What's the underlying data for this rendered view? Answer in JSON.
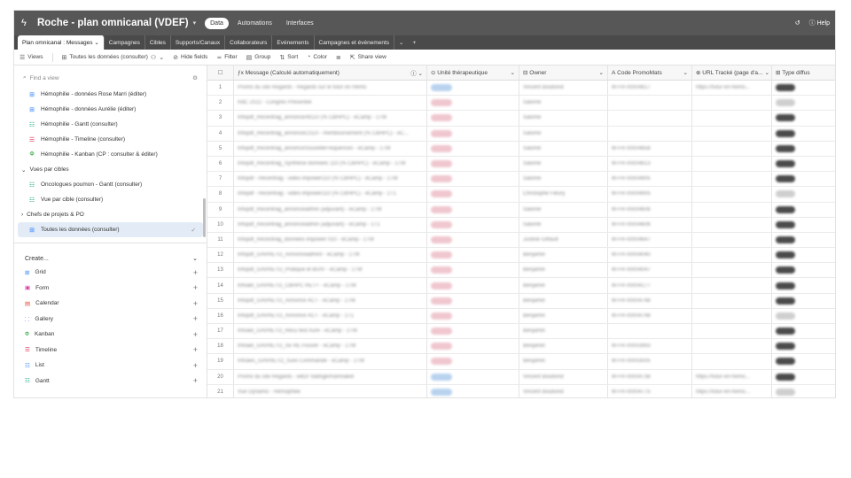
{
  "topbar": {
    "base_title": "Roche - plan omnicanal (VDEF)",
    "nav": [
      "Data",
      "Automations",
      "Interfaces"
    ],
    "help": "Help"
  },
  "tabs": [
    "Plan omnicanal : Messages",
    "Campagnes",
    "Cibles",
    "Supports/Canaux",
    "Collaborateurs",
    "Evénements",
    "Campagnes et événements"
  ],
  "viewbar": {
    "views": "Views",
    "current_view": "Toutes les données (consulter)",
    "hide_fields": "Hide fields",
    "filter": "Filter",
    "group": "Group",
    "sort": "Sort",
    "color": "Color",
    "share": "Share view"
  },
  "sidebar": {
    "search_placeholder": "Find a view",
    "items": [
      {
        "icon": "grid-icon",
        "label": "Hémophilie - données Rose Marri (éditer)"
      },
      {
        "icon": "grid-icon",
        "label": "Hémophilie - données Aurélie (éditer)"
      },
      {
        "icon": "gantt-icon",
        "label": "Hémophilie - Gantt (consulter)"
      },
      {
        "icon": "timeline-icon",
        "label": "Hémophilie - Timeline (consulter)"
      },
      {
        "icon": "kanban-icon",
        "label": "Hémophilie - Kanban (CP : consulter & éditer)"
      }
    ],
    "group1": "Vues par cibles",
    "group1_items": [
      {
        "icon": "gantt-icon",
        "label": "Oncologues poumon - Gantt (consulter)"
      },
      {
        "icon": "gantt-icon",
        "label": "Vue par cible (consulter)"
      }
    ],
    "group2": "Chefs de projets & PO",
    "selected": "Toutes les données (consulter)",
    "create_label": "Create...",
    "create_items": [
      "Grid",
      "Form",
      "Calendar",
      "Gallery",
      "Kanban",
      "Timeline",
      "List",
      "Gantt"
    ]
  },
  "grid": {
    "columns": [
      "Message (Calculé automatiquement)",
      "Unité thérapeutique",
      "Owner",
      "Code PromoMats",
      "URL Tracké (page d'a...",
      "Type diffus"
    ],
    "rows": [
      {
        "num": "1",
        "msg": "Promo du site Regards - Regards sur le futur en Hémo",
        "unit": "blue",
        "owner": "Vincent Boubond",
        "code": "M-FR-00004617",
        "url": "https://futur-en-hemo...",
        "type": "dark"
      },
      {
        "num": "2",
        "msg": "RdC 2022 - Congrès Présentiel",
        "unit": "pink",
        "owner": "Salomé",
        "code": "",
        "url": "",
        "type": "grey"
      },
      {
        "num": "3",
        "msg": "Infopdf_Recentrag_annonceAlt110 (% CBHPC) - eCamp - 1TM",
        "unit": "pink",
        "owner": "Salomé",
        "code": "",
        "url": "",
        "type": "dark"
      },
      {
        "num": "4",
        "msg": "Infopdf_Recentrag_annonceCI110 - Remboursement (% CBHPC) - eC...",
        "unit": "pink",
        "owner": "Salomé",
        "code": "",
        "url": "",
        "type": "dark"
      },
      {
        "num": "5",
        "msg": "Infopdf_Recentrag_annonceSouvelleFrequences - eCamp - 1TM",
        "unit": "pink",
        "owner": "Salomé",
        "code": "M-FR-00004658",
        "url": "",
        "type": "dark"
      },
      {
        "num": "6",
        "msg": "Infopdf_Recentrag_Synthese donnees 110 (% CBHPC) - eCamp - 1TM",
        "unit": "pink",
        "owner": "Salomé",
        "code": "M-FR-00004613",
        "url": "",
        "type": "dark"
      },
      {
        "num": "7",
        "msg": "Infopdf - Recentrag - vidéo impower110 (% CBHPC) - eCamp - 1TM",
        "unit": "pink",
        "owner": "Salomé",
        "code": "M-FR-00004905",
        "url": "",
        "type": "dark"
      },
      {
        "num": "8",
        "msg": "Infopdf - Recentrag - vidéo impower110 (% CBHPC) - eCamp - 1T1",
        "unit": "pink",
        "owner": "Christophe Fleury",
        "code": "M-FR-00004905",
        "url": "",
        "type": "grey"
      },
      {
        "num": "9",
        "msg": "Infopdf_Recentrag_annonceadmin (adjuvant) - eCamp - 1TM",
        "unit": "pink",
        "owner": "Salomé",
        "code": "M-FR-00004606",
        "url": "",
        "type": "dark"
      },
      {
        "num": "10",
        "msg": "Infopdf_Recentrag_annonceadmin (adjuvant) - eCamp - 1T1",
        "unit": "pink",
        "owner": "Salomé",
        "code": "M-FR-00004606",
        "url": "",
        "type": "dark"
      },
      {
        "num": "11",
        "msg": "Infopdf_Recentrag_données impower 010 - eCamp - 1TM",
        "unit": "pink",
        "owner": "Justine Giffault",
        "code": "M-FR-00004647",
        "url": "",
        "type": "dark"
      },
      {
        "num": "12",
        "msg": "Infopdf_GAVRETO_AnnonceadminI - eCamp - 1TM",
        "unit": "pink",
        "owner": "Benjamin",
        "code": "M-FR-00004040",
        "url": "",
        "type": "dark"
      },
      {
        "num": "13",
        "msg": "Infopdf_GAVRETO_Pratique et BUIV - eCamp - 1TM",
        "unit": "pink",
        "owner": "Benjamin",
        "code": "M-FR-00004047",
        "url": "",
        "type": "dark"
      },
      {
        "num": "14",
        "msg": "Infoael_GAVRETO_CBHPC RET+ - eCamp - 1TM",
        "unit": "pink",
        "owner": "Benjamin",
        "code": "M-FR-00004177",
        "url": "",
        "type": "dark"
      },
      {
        "num": "15",
        "msg": "Infopdf_GAVRETO_Annonce ACT - eCamp - 1TM",
        "unit": "pink",
        "owner": "Benjamin",
        "code": "M-FR-00004748",
        "url": "",
        "type": "dark"
      },
      {
        "num": "16",
        "msg": "Infopdf_GAVRETO_Annonce ACT - eCamp - 1T1",
        "unit": "pink",
        "owner": "Benjamin",
        "code": "M-FR-00004748",
        "url": "",
        "type": "grey"
      },
      {
        "num": "17",
        "msg": "Infoael_GAVRETO_Recu test Aure - eCamp - 1TM",
        "unit": "pink",
        "owner": "Benjamin",
        "code": "",
        "url": "",
        "type": "dark"
      },
      {
        "num": "18",
        "msg": "Infoael_GAVRETO_Se RETrouver - eCamp - 1TM",
        "unit": "pink",
        "owner": "Benjamin",
        "code": "M-FR-00003993",
        "url": "",
        "type": "dark"
      },
      {
        "num": "19",
        "msg": "Infoaes_GAVRETO_Suivi Commande - eCamp - 1TM",
        "unit": "pink",
        "owner": "Benjamin",
        "code": "M-FR-00003005",
        "url": "",
        "type": "dark"
      },
      {
        "num": "20",
        "msg": "Promo du site Regards - witDr Vadrige/Ramnaker",
        "unit": "blue",
        "owner": "Vincent Boubond",
        "code": "M-FR-00004738",
        "url": "https://futur-en-hemo...",
        "type": "dark"
      },
      {
        "num": "21",
        "msg": "Vue Dynamic - Hémophilie",
        "unit": "blue",
        "owner": "Vincent Boubond",
        "code": "M-FR-00004775",
        "url": "https://futur-en-hemo...",
        "type": "grey"
      }
    ]
  }
}
